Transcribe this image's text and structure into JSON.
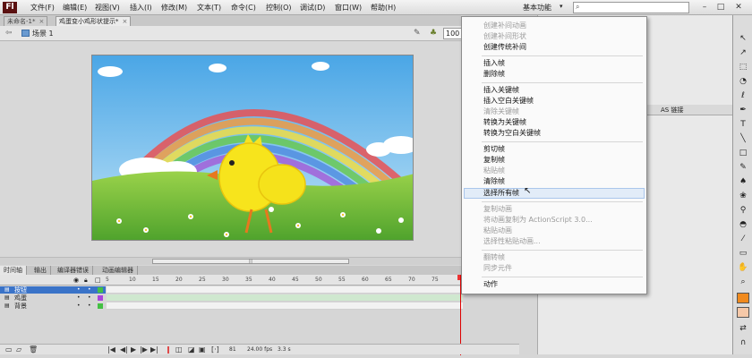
{
  "app": {
    "logo": "Fl"
  },
  "menubar": {
    "items": [
      "文件(F)",
      "编辑(E)",
      "视图(V)",
      "插入(I)",
      "修改(M)",
      "文本(T)",
      "命令(C)",
      "控制(O)",
      "调试(D)",
      "窗口(W)",
      "帮助(H)"
    ],
    "workspace": "基本功能",
    "workspace_arrow": "▾",
    "minimize": "–",
    "maximize": "□",
    "close": "✕"
  },
  "tabs": [
    {
      "label": "未命名-1*",
      "close": "×"
    },
    {
      "label": "鸡蛋变小鸡形状提示*",
      "close": "×"
    }
  ],
  "scene": {
    "label": "场景 1",
    "zoom": "100"
  },
  "timeline": {
    "tabs": [
      "时间轴",
      "输出",
      "编译器错误",
      "动画编辑器"
    ],
    "ruler": [
      "5",
      "10",
      "15",
      "20",
      "25",
      "30",
      "35",
      "40",
      "45",
      "50",
      "55",
      "60",
      "65",
      "70",
      "75",
      "80"
    ],
    "layers": [
      {
        "name": "按钮",
        "color": "#44c044"
      },
      {
        "name": "鸡蛋",
        "color": "#aa44dd"
      },
      {
        "name": "背景",
        "color": "#44c044"
      }
    ],
    "status": {
      "frame": "81",
      "fps": "24.00 fps",
      "time": "3.3 s"
    }
  },
  "properties": {
    "as_label": "AS 链接"
  },
  "context_menu": {
    "items": [
      {
        "label": "创建补间动画",
        "enabled": false
      },
      {
        "label": "创建补间形状",
        "enabled": false
      },
      {
        "label": "创建传统补间",
        "enabled": true
      },
      {
        "label": "插入帧",
        "enabled": true
      },
      {
        "label": "删除帧",
        "enabled": true
      },
      {
        "label": "插入关键帧",
        "enabled": true
      },
      {
        "label": "插入空白关键帧",
        "enabled": true
      },
      {
        "label": "清除关键帧",
        "enabled": false
      },
      {
        "label": "转换为关键帧",
        "enabled": true
      },
      {
        "label": "转换为空白关键帧",
        "enabled": true
      },
      {
        "label": "剪切帧",
        "enabled": true
      },
      {
        "label": "复制帧",
        "enabled": true
      },
      {
        "label": "粘贴帧",
        "enabled": false
      },
      {
        "label": "清除帧",
        "enabled": true
      },
      {
        "label": "选择所有帧",
        "enabled": true
      },
      {
        "label": "复制动画",
        "enabled": false
      },
      {
        "label": "将动画复制为 ActionScript 3.0...",
        "enabled": false
      },
      {
        "label": "粘贴动画",
        "enabled": false
      },
      {
        "label": "选择性粘贴动画...",
        "enabled": false
      },
      {
        "label": "翻转帧",
        "enabled": false
      },
      {
        "label": "同步元件",
        "enabled": false
      },
      {
        "label": "动作",
        "enabled": true
      }
    ]
  },
  "colors": {
    "accent": "#3a73c8",
    "playhead": "#dd0000",
    "menu_hover": "#e2ecf8"
  }
}
